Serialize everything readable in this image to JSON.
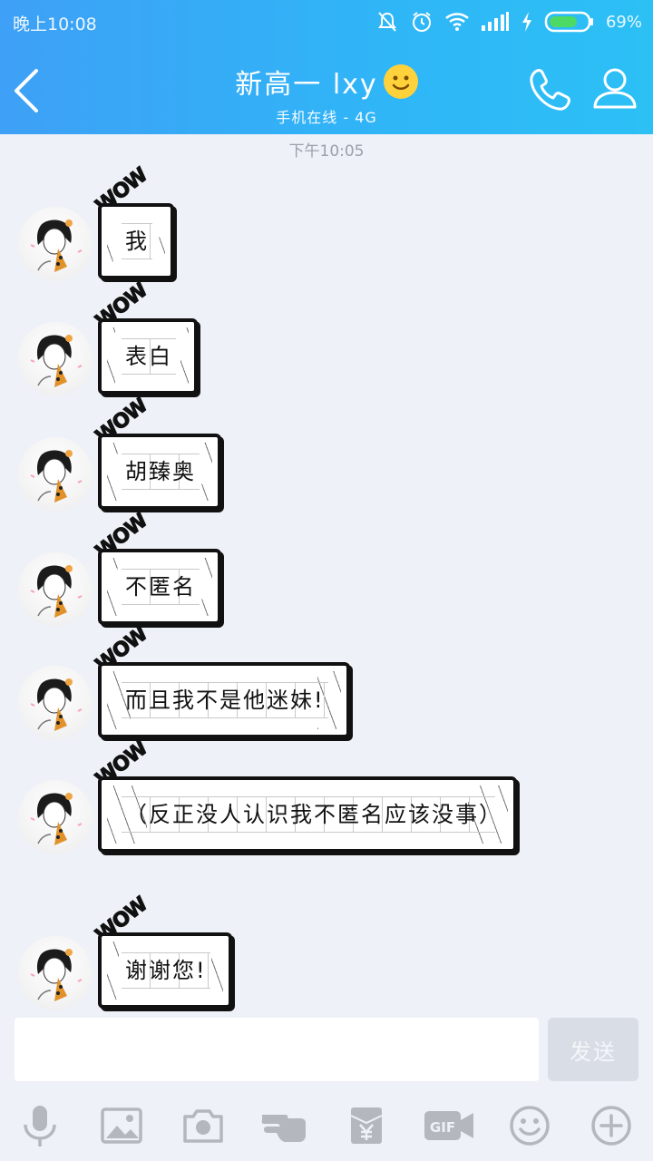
{
  "status_bar": {
    "time": "晚上10:08",
    "battery_percent": "69%"
  },
  "header": {
    "title": "新高一 lxy",
    "subtitle": "手机在线 - 4G"
  },
  "timestamp": "下午10:05",
  "messages": [
    {
      "text": "我"
    },
    {
      "text": "表白"
    },
    {
      "text": "胡臻奥"
    },
    {
      "text": "不匿名"
    },
    {
      "text": "而且我不是他迷妹!"
    },
    {
      "text": "（反正没人认识我不匿名应该没事）"
    },
    {
      "text": "谢谢您!"
    }
  ],
  "bubble_decoration": "WOW",
  "input": {
    "value": "",
    "placeholder": ""
  },
  "send_label": "发送",
  "toolbar": [
    "mic-icon",
    "image-icon",
    "camera-icon",
    "poke-icon",
    "red-packet-icon",
    "gif-icon",
    "emoji-icon",
    "plus-icon"
  ],
  "colors": {
    "header_gradient_start": "#3ea0f6",
    "header_gradient_end": "#2cc0f5",
    "background": "#eef1f7",
    "send_disabled": "#d9dde5"
  }
}
